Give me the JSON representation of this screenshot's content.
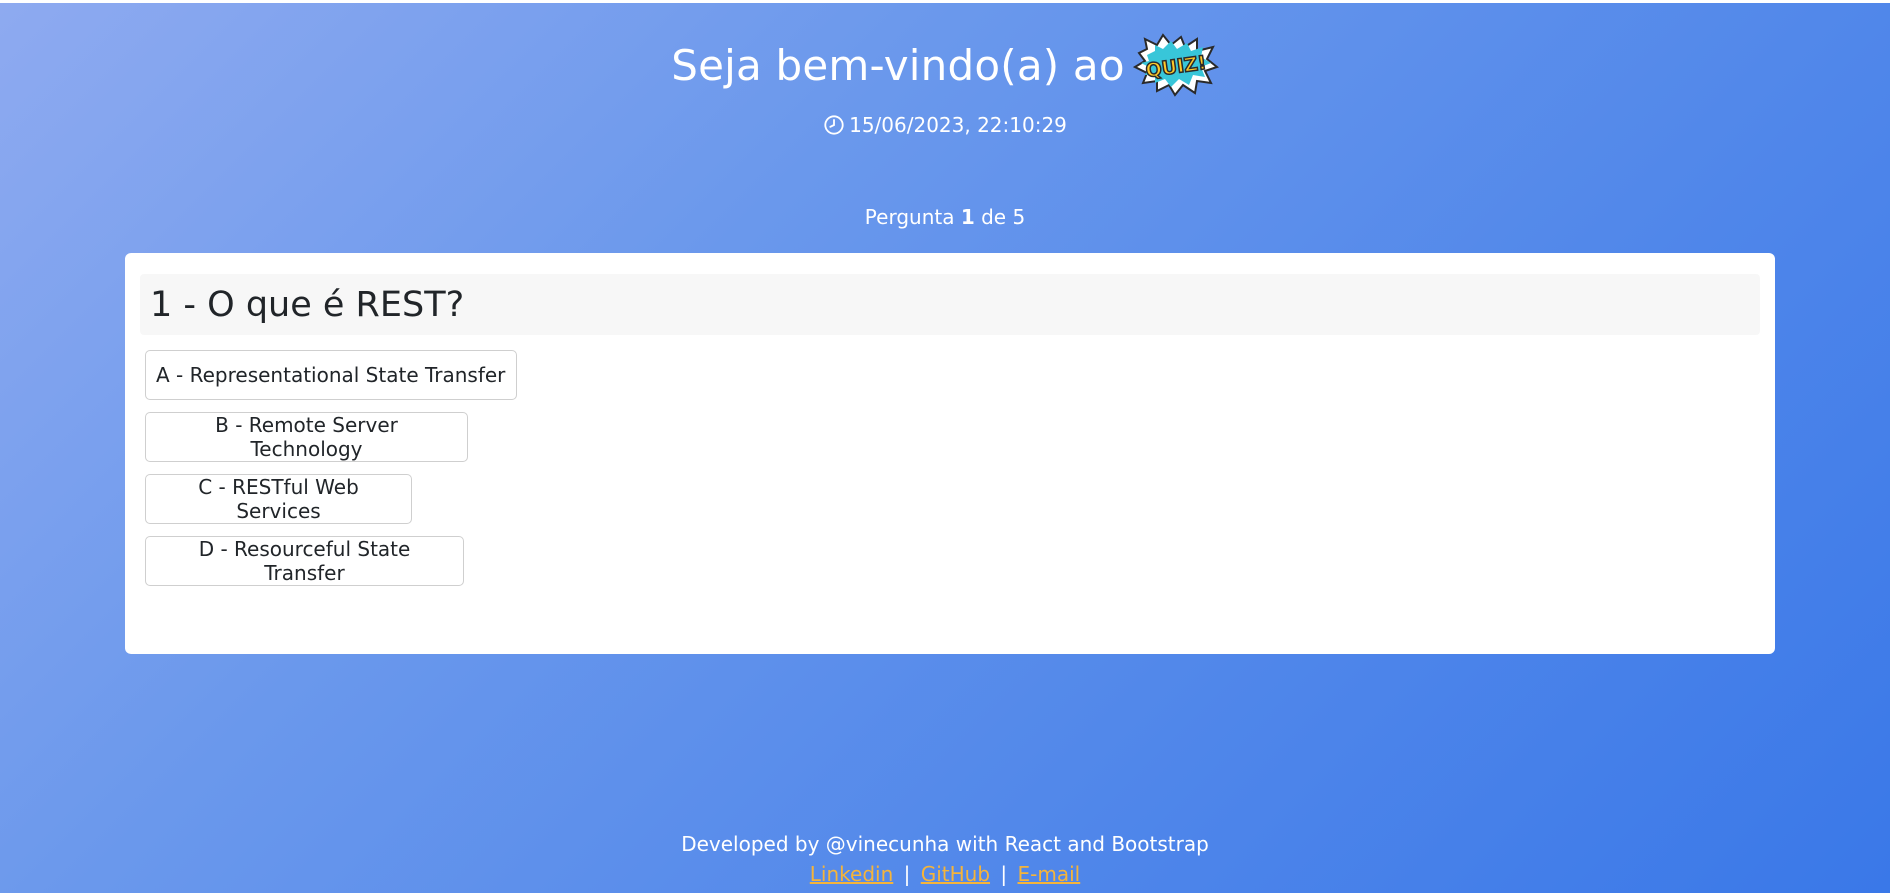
{
  "header": {
    "title": "Seja bem-vindo(a) ao",
    "logo_text": "QUIZ!"
  },
  "datetime": "15/06/2023, 22:10:29",
  "progress": {
    "prefix": "Pergunta",
    "current": "1",
    "middle": "de",
    "total": "5"
  },
  "question": {
    "text": "1 - O que é REST?",
    "options": [
      "A - Representational State Transfer",
      "B - Remote Server Technology",
      "C - RESTful Web Services",
      "D - Resourceful State Transfer"
    ]
  },
  "footer": {
    "credit": "Developed by @vinecunha with React and Bootstrap",
    "links": [
      "Linkedin",
      "GitHub",
      "E-mail"
    ],
    "separator": "|"
  },
  "colors": {
    "background_start": "#8eaaf0",
    "background_end": "#3a78e8",
    "link": "#f5b43a"
  }
}
